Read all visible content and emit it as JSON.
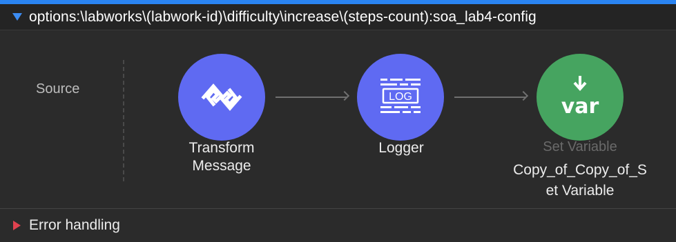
{
  "flow": {
    "title": "options:\\labworks\\(labwork-id)\\difficulty\\increase\\(steps-count):soa_lab4-config",
    "source_label": "Source"
  },
  "nodes": [
    {
      "label_line1": "Transform",
      "label_line2": "Message",
      "icon": "transform-message-icon",
      "color": "#5f6af2"
    },
    {
      "label_line1": "Logger",
      "icon": "logger-icon",
      "color": "#5f6af2"
    },
    {
      "component_type": "Set Variable",
      "label": "Copy_of_Copy_of_S et Variable",
      "label_line1": "Copy_of_Copy_of_S",
      "label_line2": "et Variable",
      "icon": "set-variable-icon",
      "icon_text": "var",
      "color": "#46a460"
    }
  ],
  "logger_icon_text": "LOG",
  "error_handling": {
    "label": "Error handling"
  },
  "colors": {
    "accent": "#2a84f2",
    "node_purple": "#5f6af2",
    "node_green": "#46a460",
    "error_triangle": "#e0424f"
  }
}
